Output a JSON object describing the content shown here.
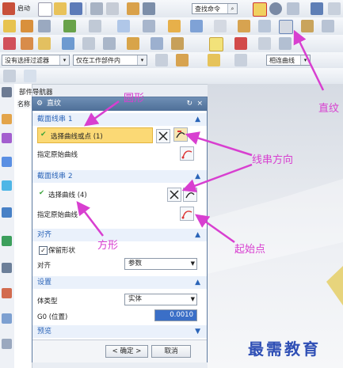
{
  "menu": {
    "start_label": "启动",
    "command_search": "查找命令"
  },
  "filter_bar": {
    "selection_filter": "没有选择过滤器",
    "scope": "仅在工作部件内",
    "snap": "相连曲线"
  },
  "navigator": {
    "title": "部件导航器",
    "name_col": "名称"
  },
  "dialog": {
    "title": "直纹",
    "section1": {
      "title": "截面线串 1",
      "select_label": "选择曲线或点 (1)",
      "origin_label": "指定原始曲线"
    },
    "section2": {
      "title": "截面线串 2",
      "select_label": "选择曲线 (4)",
      "origin_label": "指定原始曲线"
    },
    "align": {
      "title": "对齐",
      "keep_shape": "保留形状",
      "align_label": "对齐",
      "align_value": "参数"
    },
    "settings": {
      "title": "设置",
      "body_type_label": "体类型",
      "body_type_value": "实体",
      "g0_label": "G0 (位置)",
      "g0_value": "0.0010"
    },
    "preview": {
      "title": "预览"
    },
    "ok": "< 确定 >",
    "cancel": "取消"
  },
  "annotations": {
    "circle": "圆形",
    "ruled": "直纹",
    "direction": "线串方向",
    "square": "方形",
    "start_point": "起始点"
  },
  "watermark": "最需教育",
  "colors": {
    "accent_magenta": "#d83fd0",
    "title_blue": "#4e6f98",
    "section_blue": "#2a64b8",
    "highlight_yellow": "#fbd975"
  }
}
